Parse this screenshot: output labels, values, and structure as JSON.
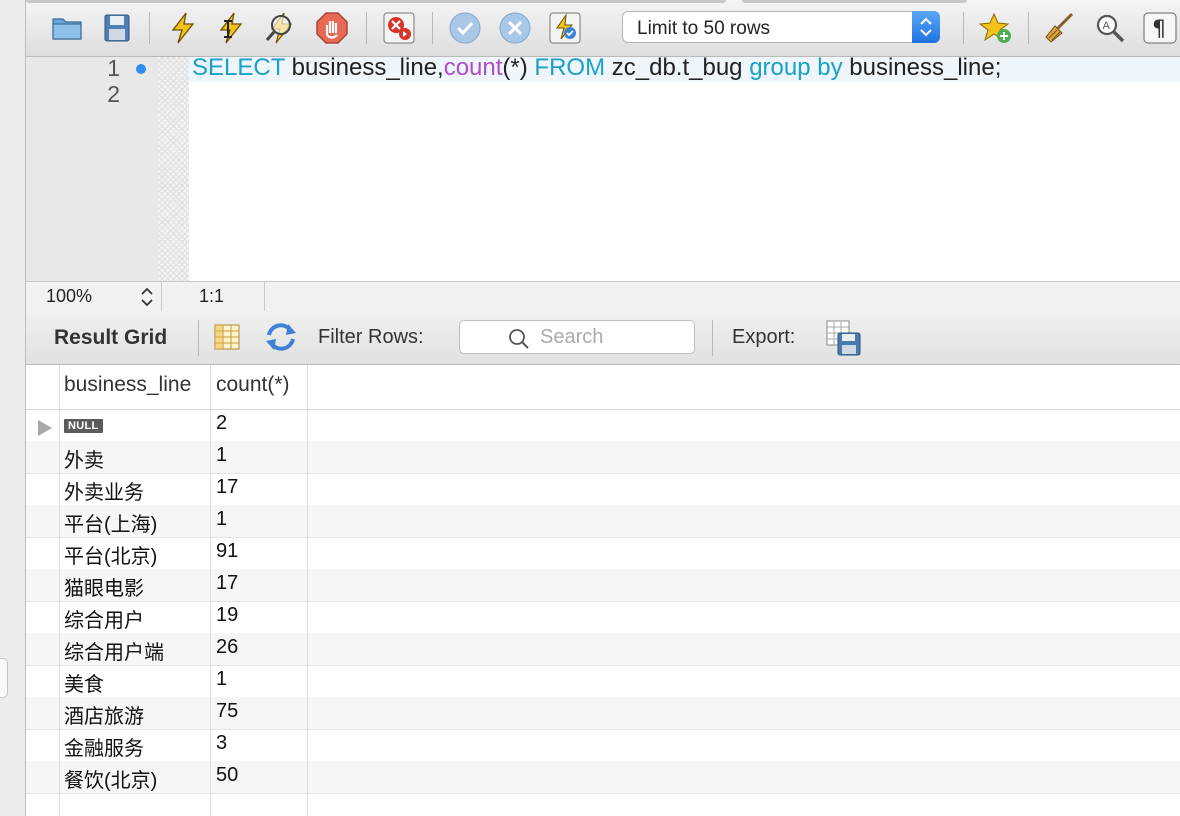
{
  "toolbar": {
    "limit_select": "Limit to 50 rows",
    "icons": [
      "folder-icon",
      "save-icon",
      "execute-icon",
      "execute-current-icon",
      "explain-icon",
      "stop-icon",
      "error-toggle-icon",
      "commit-icon",
      "rollback-icon",
      "autocommit-icon",
      "bookmark-icon",
      "beautify-icon",
      "find-icon",
      "invisibles-icon"
    ]
  },
  "editor": {
    "line_numbers": [
      "1",
      "2"
    ],
    "query": {
      "select_kw": "SELECT",
      "columns": " business_line,",
      "count_fn": "count",
      "count_args": "(*) ",
      "from_kw": "FROM",
      "table": " zc_db.t_bug ",
      "group_kw": "group by",
      "group_col": " business_line;"
    }
  },
  "status": {
    "zoom": "100%",
    "cursor": "1:1"
  },
  "results_toolbar": {
    "result_grid_label": "Result Grid",
    "filter_label": "Filter Rows:",
    "search_placeholder": "Search",
    "export_label": "Export:"
  },
  "grid": {
    "columns": [
      "business_line",
      "count(*)"
    ],
    "rows": [
      {
        "business_line": "NULL",
        "count": "2"
      },
      {
        "business_line": "外卖",
        "count": "1"
      },
      {
        "business_line": "外卖业务",
        "count": "17"
      },
      {
        "business_line": "平台(上海)",
        "count": "1"
      },
      {
        "business_line": "平台(北京)",
        "count": "91"
      },
      {
        "business_line": "猫眼电影",
        "count": "17"
      },
      {
        "business_line": "综合用户",
        "count": "19"
      },
      {
        "business_line": "综合用户端",
        "count": "26"
      },
      {
        "business_line": "美食",
        "count": "1"
      },
      {
        "business_line": "酒店旅游",
        "count": "75"
      },
      {
        "business_line": "金融服务",
        "count": "3"
      },
      {
        "business_line": "餐饮(北京)",
        "count": "50"
      }
    ]
  },
  "colors": {
    "keyword": "#1aa0c9",
    "function": "#b14cc8",
    "accent": "#2f8df0"
  }
}
